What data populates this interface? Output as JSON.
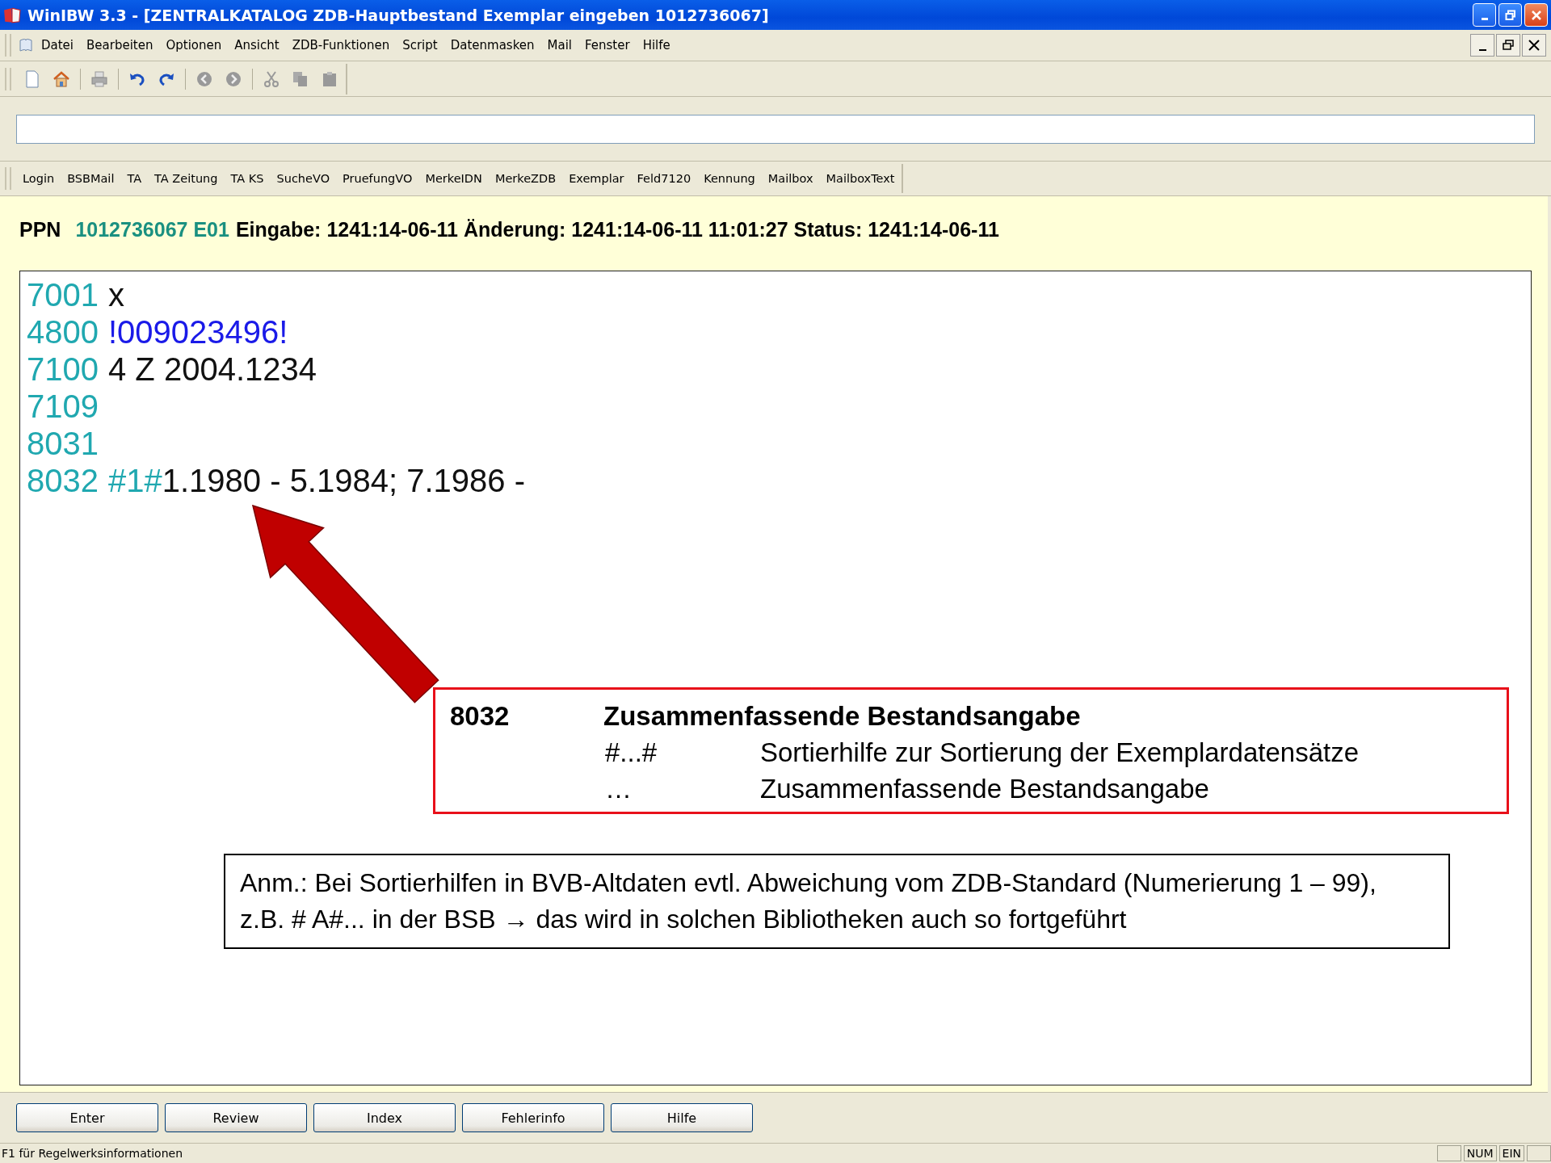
{
  "window": {
    "title": "WinIBW 3.3 - [ZENTRALKATALOG ZDB-Hauptbestand Exemplar eingeben 1012736067]"
  },
  "menu": [
    "Datei",
    "Bearbeiten",
    "Optionen",
    "Ansicht",
    "ZDB-Funktionen",
    "Script",
    "Datenmasken",
    "Mail",
    "Fenster",
    "Hilfe"
  ],
  "scripts": [
    "Login",
    "BSBMail",
    "TA",
    "TA Zeitung",
    "TA KS",
    "SucheVO",
    "PruefungVO",
    "MerkeIDN",
    "MerkeZDB",
    "Exemplar",
    "Feld7120",
    "Kennung",
    "Mailbox",
    "MailboxText"
  ],
  "record_header": {
    "label": "PPN",
    "ppn": "1012736067 E01",
    "info": "Eingabe: 1241:14-06-11 Änderung: 1241:14-06-11 11:01:27 Status: 1241:14-06-11"
  },
  "editor_lines": [
    {
      "tag": "7001",
      "segments": [
        {
          "kind": "plain",
          "text": "x"
        }
      ]
    },
    {
      "tag": "4800",
      "segments": [
        {
          "kind": "link",
          "text": "!009023496!"
        }
      ]
    },
    {
      "tag": "7100",
      "segments": [
        {
          "kind": "plain",
          "text": "4 Z 2004.1234"
        }
      ]
    },
    {
      "tag": "7109"
    },
    {
      "tag": "8031"
    },
    {
      "tag": "8032",
      "segments": [
        {
          "kind": "subfield",
          "text": "#1#"
        },
        {
          "kind": "plain",
          "text": "1.1980 - 5.1984; 7.1986 -"
        }
      ]
    }
  ],
  "field_info": {
    "code": "8032",
    "title": "Zusammenfassende Bestandsangabe",
    "rows": [
      {
        "symbol": "#...#",
        "text": "Sortierhilfe zur Sortierung der Exemplardatensätze"
      },
      {
        "symbol": "…",
        "text": "Zusammenfassende Bestandsangabe"
      }
    ]
  },
  "note": "Anm.: Bei Sortierhilfen in BVB-Altdaten evtl. Abweichung vom ZDB-Standard (Numerierung 1 – 99), z.B. # A#... in der BSB → das wird in solchen Bibliotheken auch so fortgeführt",
  "buttons": [
    "Enter",
    "Review",
    "Index",
    "Fehlerinfo",
    "Hilfe"
  ],
  "status_bar": {
    "text": "F1 für Regelwerksinformationen",
    "indicators": [
      "NUM",
      "EIN"
    ]
  }
}
